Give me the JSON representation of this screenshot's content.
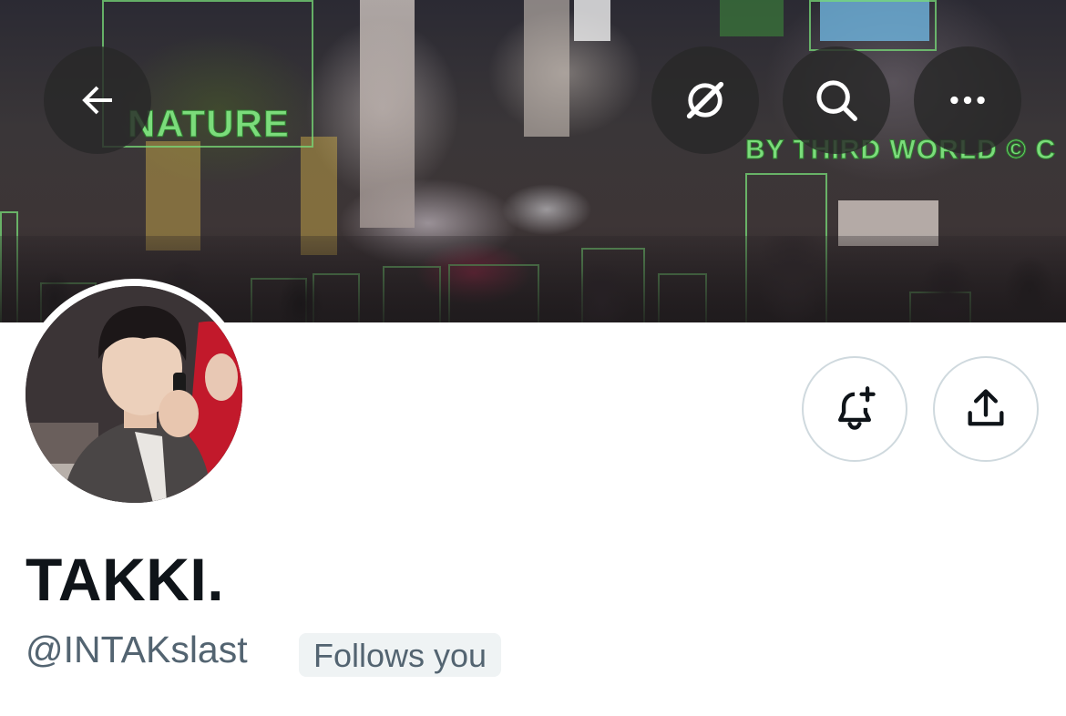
{
  "banner": {
    "text_left": "NATURE",
    "text_right": "BY THIRD WORLD © C"
  },
  "header_buttons": {
    "back_icon": "arrow-left-icon",
    "grok_icon": "grok-icon",
    "search_icon": "search-icon",
    "more_icon": "more-horizontal-icon"
  },
  "actions": {
    "notify_icon": "bell-plus-icon",
    "share_icon": "share-upload-icon"
  },
  "profile": {
    "display_name": "TAKKI.",
    "handle": "@INTAKslast",
    "follows_badge": "Follows you"
  },
  "colors": {
    "text_primary": "#0f1419",
    "text_secondary": "#536471",
    "badge_bg": "#eff3f4",
    "border": "#cfd9de",
    "overlay_button": "#282828"
  }
}
